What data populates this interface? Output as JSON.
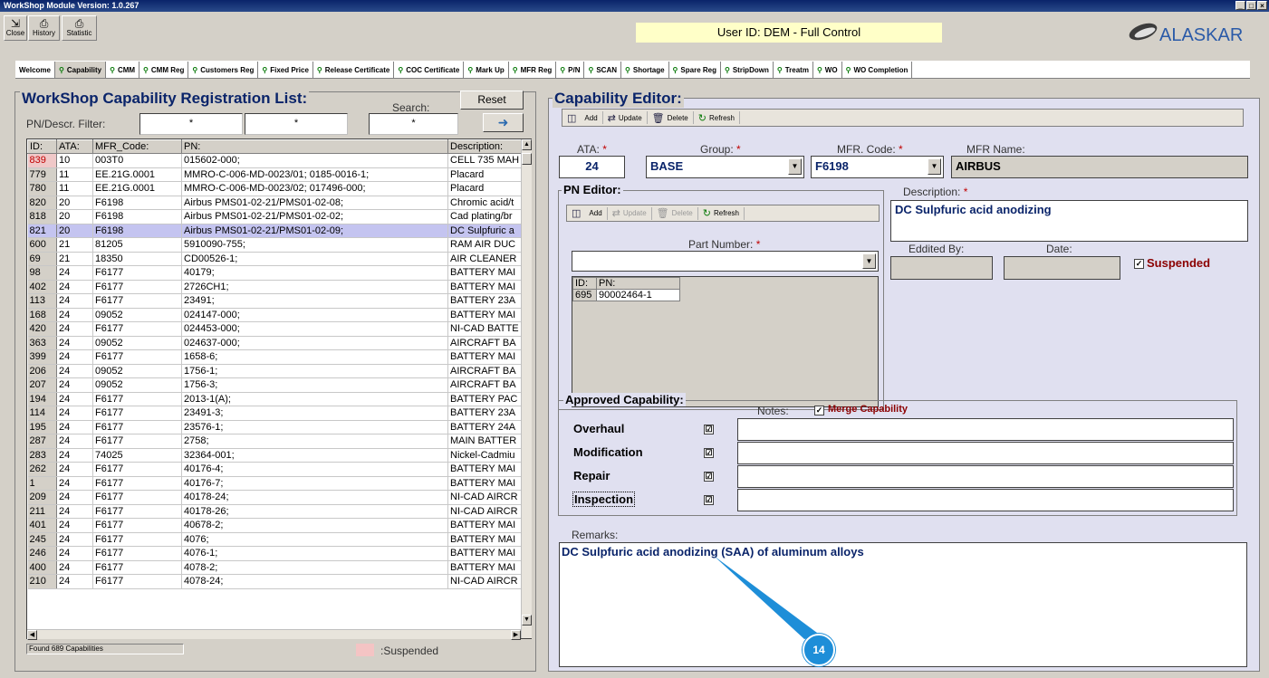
{
  "window": {
    "title": "WorkShop Module  Version: 1.0.267",
    "controls": [
      "_",
      "□",
      "×"
    ]
  },
  "toolbar": {
    "buttons": [
      {
        "label": "Close",
        "icon": "door-exit-icon"
      },
      {
        "label": "History",
        "icon": "printer-icon"
      },
      {
        "label": "Statistic",
        "icon": "printer-icon"
      }
    ],
    "user_id": "User ID: DEM - Full Control",
    "logo_text": "ALASKAR"
  },
  "tabs": [
    "Welcome",
    "Capability",
    "CMM",
    "CMM Reg",
    "Customers Reg",
    "Fixed Price",
    "Release Certificate",
    "COC Certificate",
    "Mark Up",
    "MFR Reg",
    "P/N",
    "SCAN",
    "Shortage",
    "Spare Reg",
    "StripDown",
    "Treatm",
    "WO",
    "WO Completion"
  ],
  "active_tab": "Capability",
  "list_panel": {
    "title": "WorkShop Capability Registration List:",
    "filter_label": "PN/Descr. Filter:",
    "filter1": "*",
    "filter2": "*",
    "search_label": "Search:",
    "search_value": "*",
    "reset_label": "Reset",
    "go_icon": "arrow-right-icon",
    "columns": [
      "ID:",
      "ATA:",
      "MFR_Code:",
      "PN:",
      "Description:"
    ],
    "rows": [
      [
        "839",
        "10",
        "003T0",
        "015602-000;",
        "CELL 735 MAH"
      ],
      [
        "779",
        "11",
        "EE.21G.0001",
        "MMRO-C-006-MD-0023/01; 0185-0016-1;",
        "Placard"
      ],
      [
        "780",
        "11",
        "EE.21G.0001",
        "MMRO-C-006-MD-0023/02; 017496-000;",
        "Placard"
      ],
      [
        "820",
        "20",
        "F6198",
        "Airbus PMS01-02-21/PMS01-02-08;",
        "Chromic acid/t"
      ],
      [
        "818",
        "20",
        "F6198",
        "Airbus PMS01-02-21/PMS01-02-02;",
        "Cad plating/br"
      ],
      [
        "821",
        "20",
        "F6198",
        "Airbus PMS01-02-21/PMS01-02-09;",
        "DC Sulpfuric a"
      ],
      [
        "600",
        "21",
        "81205",
        "5910090-755;",
        "RAM AIR DUC"
      ],
      [
        "69",
        "21",
        "18350",
        "CD00526-1;",
        "AIR CLEANER"
      ],
      [
        "98",
        "24",
        "F6177",
        "40179;",
        "BATTERY MAI"
      ],
      [
        "402",
        "24",
        "F6177",
        "2726CH1;",
        "BATTERY MAI"
      ],
      [
        "113",
        "24",
        "F6177",
        "23491;",
        "BATTERY 23A"
      ],
      [
        "168",
        "24",
        "09052",
        "024147-000;",
        "BATTERY MAI"
      ],
      [
        "420",
        "24",
        "F6177",
        "024453-000;",
        "NI-CAD BATTE"
      ],
      [
        "363",
        "24",
        "09052",
        "024637-000;",
        "AIRCRAFT BA"
      ],
      [
        "399",
        "24",
        "F6177",
        "1658-6;",
        "BATTERY MAI"
      ],
      [
        "206",
        "24",
        "09052",
        "1756-1;",
        "AIRCRAFT BA"
      ],
      [
        "207",
        "24",
        "09052",
        "1756-3;",
        "AIRCRAFT BA"
      ],
      [
        "194",
        "24",
        "F6177",
        "2013-1(A);",
        "BATTERY PAC"
      ],
      [
        "114",
        "24",
        "F6177",
        "23491-3;",
        "BATTERY 23A"
      ],
      [
        "195",
        "24",
        "F6177",
        "23576-1;",
        "BATTERY 24A"
      ],
      [
        "287",
        "24",
        "F6177",
        "2758;",
        "MAIN BATTER"
      ],
      [
        "283",
        "24",
        "74025",
        "32364-001;",
        "Nickel-Cadmiu"
      ],
      [
        "262",
        "24",
        "F6177",
        "40176-4;",
        "BATTERY MAI"
      ],
      [
        "1",
        "24",
        "F6177",
        "40176-7;",
        "BATTERY MAI"
      ],
      [
        "209",
        "24",
        "F6177",
        "40178-24;",
        "NI-CAD AIRCR"
      ],
      [
        "211",
        "24",
        "F6177",
        "40178-26;",
        "NI-CAD AIRCR"
      ],
      [
        "401",
        "24",
        "F6177",
        "40678-2;",
        "BATTERY MAI"
      ],
      [
        "245",
        "24",
        "F6177",
        "4076;",
        "BATTERY MAI"
      ],
      [
        "246",
        "24",
        "F6177",
        "4076-1;",
        "BATTERY MAI"
      ],
      [
        "400",
        "24",
        "F6177",
        "4078-2;",
        "BATTERY MAI"
      ],
      [
        "210",
        "24",
        "F6177",
        "4078-24;",
        "NI-CAD AIRCR"
      ]
    ],
    "selected_row_id": "821",
    "suspended_row_ids": [
      "839"
    ],
    "status": "Found 689 Capabilities",
    "suspended_legend": ":Suspended"
  },
  "editor": {
    "title": "Capability Editor:",
    "toolbar": [
      "Add",
      "Update",
      "Delete",
      "Refresh"
    ],
    "ata_label": "ATA:",
    "ata_value": "24",
    "group_label": "Group:",
    "group_value": "BASE",
    "mfr_code_label": "MFR. Code:",
    "mfr_code_value": "F6198",
    "mfr_name_label": "MFR Name:",
    "mfr_name_value": "AIRBUS",
    "pn_editor": {
      "title": "PN Editor:",
      "toolbar": [
        "Add",
        "Update",
        "Delete",
        "Refresh"
      ],
      "part_number_label": "Part Number:",
      "part_number_value": "",
      "columns": [
        "ID:",
        "PN:"
      ],
      "rows": [
        [
          "695",
          "90002464-1"
        ]
      ]
    },
    "description_label": "Description:",
    "description_value": "DC Sulpfuric acid anodizing",
    "edited_by_label": "Eddited By:",
    "date_label": "Date:",
    "suspended_label": "Suspended",
    "approved": {
      "title": "Approved Capability:",
      "notes_label": "Notes:",
      "merge_label": "Merge Capability",
      "items": [
        {
          "label": "Overhaul",
          "checked": "☑"
        },
        {
          "label": "Modification",
          "checked": "☑"
        },
        {
          "label": "Repair",
          "checked": "☑"
        },
        {
          "label": "Inspection",
          "checked": "☑"
        }
      ]
    },
    "remarks_label": "Remarks:",
    "remarks_value": "DC Sulpfuric acid anodizing (SAA) of aluminum alloys"
  },
  "callout": {
    "number": "14",
    "color": "#1e8ed8"
  }
}
